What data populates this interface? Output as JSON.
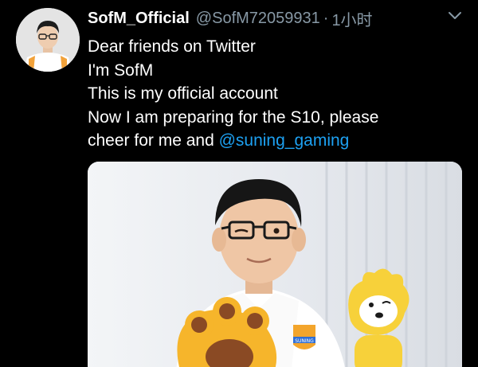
{
  "tweet": {
    "author": {
      "display_name": "SofM_Official",
      "handle": "@SofM72059931",
      "avatar_icon": "profile-photo"
    },
    "separator": "·",
    "timestamp": "1小时",
    "menu_icon": "chevron-down-icon",
    "text_lines": [
      "Dear friends on Twitter",
      "I'm SofM",
      "This is my official account",
      "Now I am preparing for the S10, please",
      "cheer for me and "
    ],
    "mention": "@suning_gaming",
    "media": {
      "badge_text": "SUNING"
    },
    "colors": {
      "background": "#000000",
      "secondary_text": "#8899a6",
      "link": "#1da1f2"
    }
  }
}
